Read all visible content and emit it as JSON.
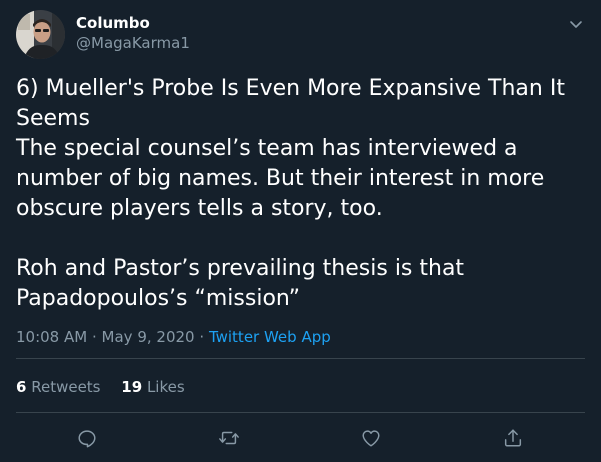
{
  "user": {
    "name": "Columbo",
    "handle": "@MagaKarma1"
  },
  "tweet": {
    "lines": [
      "6) Mueller's Probe Is Even More Expansive Than It Seems",
      "The special counsel’s team has interviewed a number of big names. But their interest in more obscure players tells a story, too.",
      "",
      "Roh and Pastor’s prevailing thesis is that Papadopoulos’s “mission”"
    ]
  },
  "meta": {
    "time": "10:08 AM",
    "separator": "·",
    "date": "May 9, 2020",
    "source": "Twitter Web App"
  },
  "stats": {
    "retweets_count": "6",
    "retweets_label": "Retweets",
    "likes_count": "19",
    "likes_label": "Likes"
  },
  "icons": {
    "caret": "chevron-down-icon",
    "reply": "reply-icon",
    "retweet": "retweet-icon",
    "like": "heart-icon",
    "share": "share-icon"
  },
  "colors": {
    "background": "#15202b",
    "text": "#ffffff",
    "secondary": "#8899a6",
    "link": "#1da1f2",
    "divider": "#38444d"
  }
}
